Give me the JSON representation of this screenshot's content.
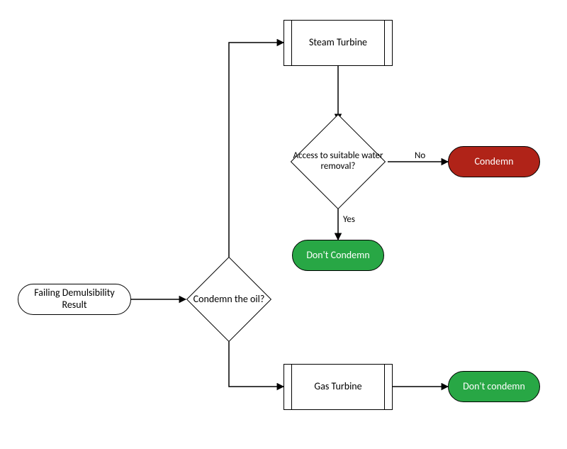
{
  "nodes": {
    "start": {
      "label": "Failing Demulsibility Result"
    },
    "decision_condemn": {
      "label": "Condemn the oil?"
    },
    "steam": {
      "label": "Steam Turbine"
    },
    "gas": {
      "label": "Gas Turbine"
    },
    "decision_water": {
      "label": "Access to suitable water removal?"
    },
    "condemn_red": {
      "label": "Condemn"
    },
    "dont_condemn1": {
      "label": "Don't Condemn"
    },
    "dont_condemn2": {
      "label": "Don't condemn"
    }
  },
  "edges": {
    "no": "No",
    "yes": "Yes"
  },
  "colors": {
    "green": "#28a745",
    "red": "#b02318"
  }
}
